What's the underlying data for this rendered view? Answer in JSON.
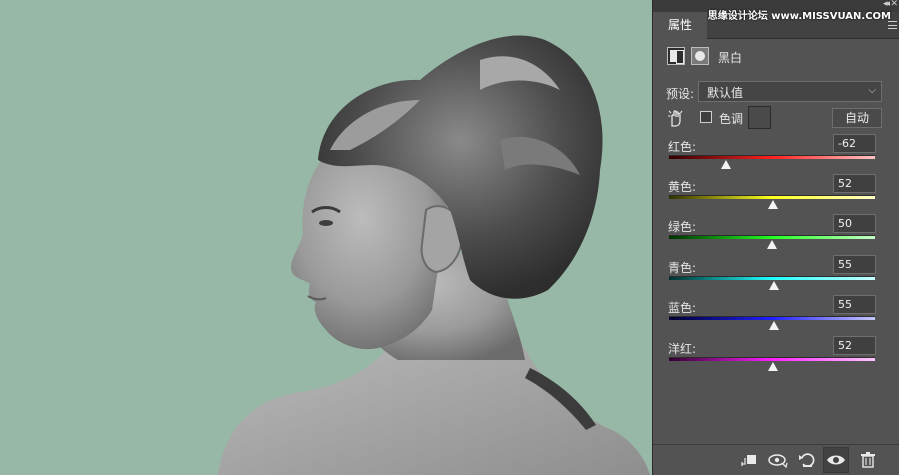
{
  "panel": {
    "tab_label": "属性",
    "watermark": "思缘设计论坛 www.MISSVUAN.COM",
    "adjustment_title": "黑白",
    "preset_label": "预设:",
    "preset_value": "默认值",
    "tint_label": "色调",
    "auto_label": "自动",
    "sliders": [
      {
        "label": "红色:",
        "value": "-62",
        "colors": [
          "#300000",
          "#ff2020",
          "#ffc4c4"
        ]
      },
      {
        "label": "黄色:",
        "value": "52",
        "colors": [
          "#303000",
          "#ffff20",
          "#ffffc8"
        ]
      },
      {
        "label": "绿色:",
        "value": "50",
        "colors": [
          "#003000",
          "#20ff20",
          "#c8ffc8"
        ]
      },
      {
        "label": "青色:",
        "value": "55",
        "colors": [
          "#003030",
          "#20ffff",
          "#c8ffff"
        ]
      },
      {
        "label": "蓝色:",
        "value": "55",
        "colors": [
          "#000030",
          "#2020ff",
          "#c8c8ff"
        ]
      },
      {
        "label": "洋红:",
        "value": "52",
        "colors": [
          "#300030",
          "#ff20ff",
          "#ffc8ff"
        ]
      }
    ],
    "toolbar_icons": [
      "clip-to-layer-icon",
      "view-previous-state-icon",
      "reset-icon",
      "visibility-eye-icon",
      "trash-icon"
    ]
  },
  "canvas": {
    "background_color": "#97b8a6",
    "image_description_icon": "grayscale-portrait-photo"
  }
}
